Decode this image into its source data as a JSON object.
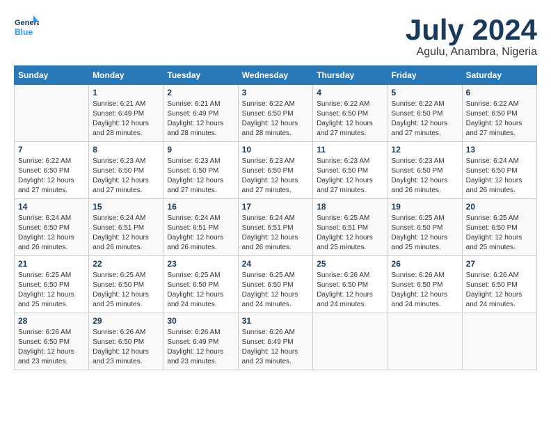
{
  "header": {
    "logo_line1": "General",
    "logo_line2": "Blue",
    "month": "July 2024",
    "location": "Agulu, Anambra, Nigeria"
  },
  "days_of_week": [
    "Sunday",
    "Monday",
    "Tuesday",
    "Wednesday",
    "Thursday",
    "Friday",
    "Saturday"
  ],
  "weeks": [
    [
      {
        "day": "",
        "detail": ""
      },
      {
        "day": "1",
        "detail": "Sunrise: 6:21 AM\nSunset: 6:49 PM\nDaylight: 12 hours\nand 28 minutes."
      },
      {
        "day": "2",
        "detail": "Sunrise: 6:21 AM\nSunset: 6:49 PM\nDaylight: 12 hours\nand 28 minutes."
      },
      {
        "day": "3",
        "detail": "Sunrise: 6:22 AM\nSunset: 6:50 PM\nDaylight: 12 hours\nand 28 minutes."
      },
      {
        "day": "4",
        "detail": "Sunrise: 6:22 AM\nSunset: 6:50 PM\nDaylight: 12 hours\nand 27 minutes."
      },
      {
        "day": "5",
        "detail": "Sunrise: 6:22 AM\nSunset: 6:50 PM\nDaylight: 12 hours\nand 27 minutes."
      },
      {
        "day": "6",
        "detail": "Sunrise: 6:22 AM\nSunset: 6:50 PM\nDaylight: 12 hours\nand 27 minutes."
      }
    ],
    [
      {
        "day": "7",
        "detail": ""
      },
      {
        "day": "8",
        "detail": "Sunrise: 6:23 AM\nSunset: 6:50 PM\nDaylight: 12 hours\nand 27 minutes."
      },
      {
        "day": "9",
        "detail": "Sunrise: 6:23 AM\nSunset: 6:50 PM\nDaylight: 12 hours\nand 27 minutes."
      },
      {
        "day": "10",
        "detail": "Sunrise: 6:23 AM\nSunset: 6:50 PM\nDaylight: 12 hours\nand 27 minutes."
      },
      {
        "day": "11",
        "detail": "Sunrise: 6:23 AM\nSunset: 6:50 PM\nDaylight: 12 hours\nand 27 minutes."
      },
      {
        "day": "12",
        "detail": "Sunrise: 6:23 AM\nSunset: 6:50 PM\nDaylight: 12 hours\nand 26 minutes."
      },
      {
        "day": "13",
        "detail": "Sunrise: 6:24 AM\nSunset: 6:50 PM\nDaylight: 12 hours\nand 26 minutes."
      }
    ],
    [
      {
        "day": "14",
        "detail": ""
      },
      {
        "day": "15",
        "detail": "Sunrise: 6:24 AM\nSunset: 6:51 PM\nDaylight: 12 hours\nand 26 minutes."
      },
      {
        "day": "16",
        "detail": "Sunrise: 6:24 AM\nSunset: 6:51 PM\nDaylight: 12 hours\nand 26 minutes."
      },
      {
        "day": "17",
        "detail": "Sunrise: 6:24 AM\nSunset: 6:51 PM\nDaylight: 12 hours\nand 26 minutes."
      },
      {
        "day": "18",
        "detail": "Sunrise: 6:25 AM\nSunset: 6:51 PM\nDaylight: 12 hours\nand 25 minutes."
      },
      {
        "day": "19",
        "detail": "Sunrise: 6:25 AM\nSunset: 6:50 PM\nDaylight: 12 hours\nand 25 minutes."
      },
      {
        "day": "20",
        "detail": "Sunrise: 6:25 AM\nSunset: 6:50 PM\nDaylight: 12 hours\nand 25 minutes."
      }
    ],
    [
      {
        "day": "21",
        "detail": ""
      },
      {
        "day": "22",
        "detail": "Sunrise: 6:25 AM\nSunset: 6:50 PM\nDaylight: 12 hours\nand 25 minutes."
      },
      {
        "day": "23",
        "detail": "Sunrise: 6:25 AM\nSunset: 6:50 PM\nDaylight: 12 hours\nand 24 minutes."
      },
      {
        "day": "24",
        "detail": "Sunrise: 6:25 AM\nSunset: 6:50 PM\nDaylight: 12 hours\nand 24 minutes."
      },
      {
        "day": "25",
        "detail": "Sunrise: 6:26 AM\nSunset: 6:50 PM\nDaylight: 12 hours\nand 24 minutes."
      },
      {
        "day": "26",
        "detail": "Sunrise: 6:26 AM\nSunset: 6:50 PM\nDaylight: 12 hours\nand 24 minutes."
      },
      {
        "day": "27",
        "detail": "Sunrise: 6:26 AM\nSunset: 6:50 PM\nDaylight: 12 hours\nand 24 minutes."
      }
    ],
    [
      {
        "day": "28",
        "detail": "Sunrise: 6:26 AM\nSunset: 6:50 PM\nDaylight: 12 hours\nand 23 minutes."
      },
      {
        "day": "29",
        "detail": "Sunrise: 6:26 AM\nSunset: 6:50 PM\nDaylight: 12 hours\nand 23 minutes."
      },
      {
        "day": "30",
        "detail": "Sunrise: 6:26 AM\nSunset: 6:49 PM\nDaylight: 12 hours\nand 23 minutes."
      },
      {
        "day": "31",
        "detail": "Sunrise: 6:26 AM\nSunset: 6:49 PM\nDaylight: 12 hours\nand 23 minutes."
      },
      {
        "day": "",
        "detail": ""
      },
      {
        "day": "",
        "detail": ""
      },
      {
        "day": "",
        "detail": ""
      }
    ]
  ]
}
